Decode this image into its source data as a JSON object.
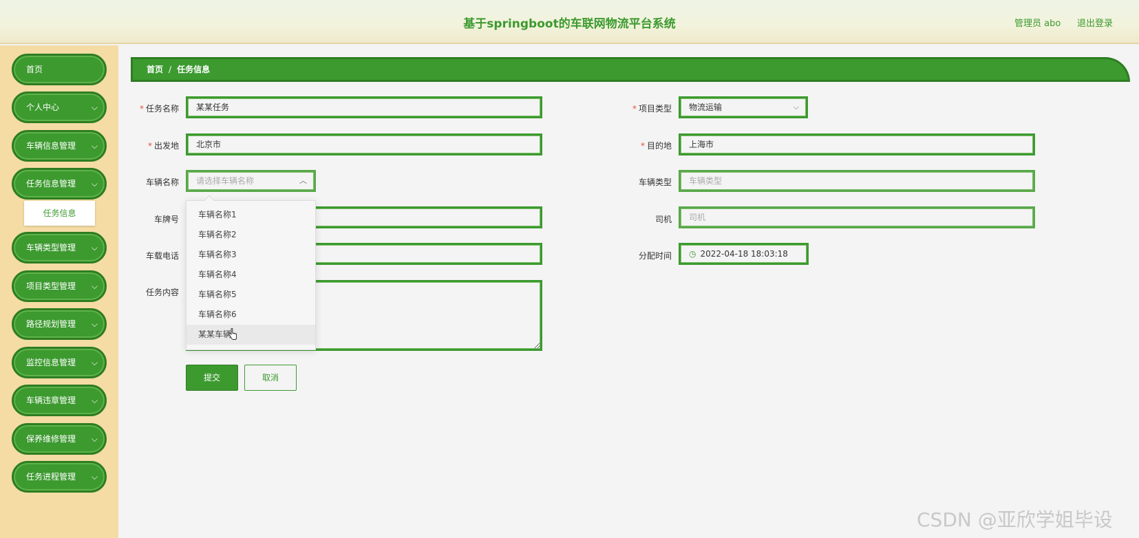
{
  "header": {
    "title": "基于springboot的车联网物流平台系统",
    "user": "管理员 abo",
    "logout": "退出登录"
  },
  "sidebar": {
    "items": [
      {
        "label": "首页",
        "has_chevron": false
      },
      {
        "label": "个人中心",
        "has_chevron": true
      },
      {
        "label": "车辆信息管理",
        "has_chevron": true
      },
      {
        "label": "任务信息管理",
        "has_chevron": true
      },
      {
        "label": "车辆类型管理",
        "has_chevron": true
      },
      {
        "label": "项目类型管理",
        "has_chevron": true
      },
      {
        "label": "路径规划管理",
        "has_chevron": true
      },
      {
        "label": "监控信息管理",
        "has_chevron": true
      },
      {
        "label": "车辆违章管理",
        "has_chevron": true
      },
      {
        "label": "保养维修管理",
        "has_chevron": true
      },
      {
        "label": "任务进程管理",
        "has_chevron": true
      }
    ],
    "sub_item": "任务信息"
  },
  "breadcrumb": {
    "home": "首页",
    "separator": "/",
    "current": "任务信息"
  },
  "form": {
    "task_name": {
      "label": "任务名称",
      "value": "某某任务"
    },
    "project_type": {
      "label": "项目类型",
      "value": "物流运输"
    },
    "origin": {
      "label": "出发地",
      "value": "北京市"
    },
    "destination": {
      "label": "目的地",
      "value": "上海市"
    },
    "vehicle_name": {
      "label": "车辆名称",
      "placeholder": "请选择车辆名称"
    },
    "vehicle_type": {
      "label": "车辆类型",
      "placeholder": "车辆类型"
    },
    "plate_number": {
      "label": "车牌号",
      "value": ""
    },
    "driver": {
      "label": "司机",
      "placeholder": "司机"
    },
    "vehicle_phone": {
      "label": "车载电话",
      "value": ""
    },
    "assign_time": {
      "label": "分配时间",
      "value": "2022-04-18 18:03:18"
    },
    "task_content": {
      "label": "任务内容",
      "value": ""
    },
    "required_mark": "*"
  },
  "dropdown": {
    "options": [
      "车辆名称1",
      "车辆名称2",
      "车辆名称3",
      "车辆名称4",
      "车辆名称5",
      "车辆名称6",
      "某某车辆"
    ],
    "hovered_index": 6
  },
  "buttons": {
    "submit": "提交",
    "cancel": "取消"
  },
  "watermark": "CSDN @亚欣学姐毕设",
  "colors": {
    "primary": "#3c9a2f",
    "sidebar_bg": "#f4dca4",
    "required": "#e0533c"
  }
}
